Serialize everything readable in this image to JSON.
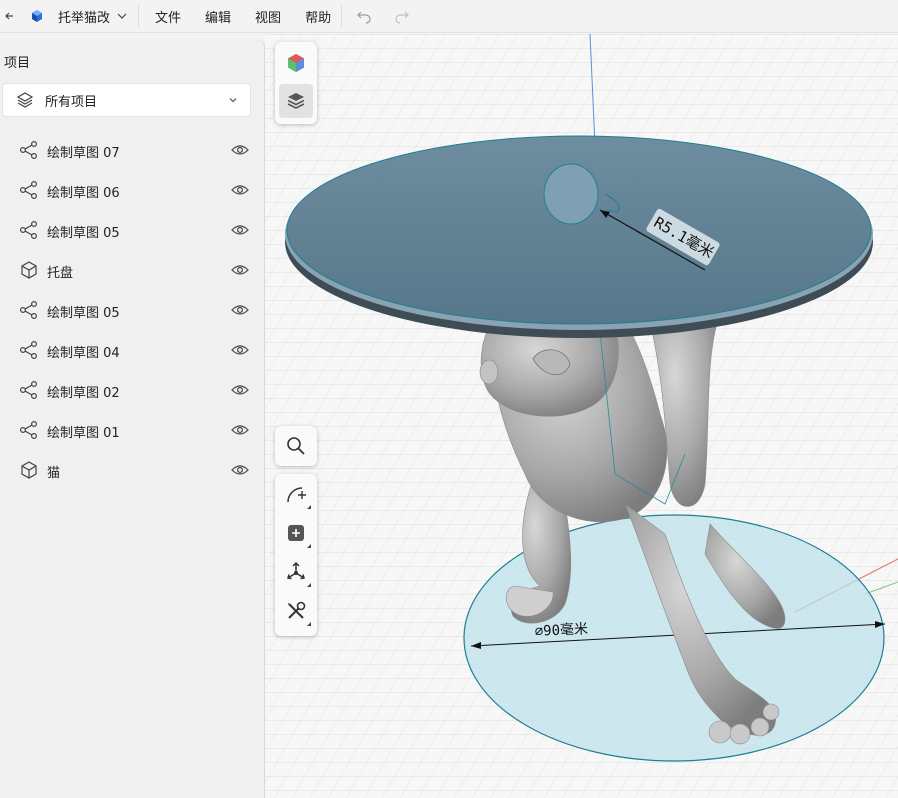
{
  "menubar": {
    "document_title": "托举猫改",
    "menus": [
      "文件",
      "编辑",
      "视图",
      "帮助"
    ]
  },
  "panel": {
    "title": "项目",
    "filter_label": "所有项目",
    "items": [
      {
        "label": "绘制草图 07",
        "icon": "sketch-icon"
      },
      {
        "label": "绘制草图 06",
        "icon": "sketch-icon"
      },
      {
        "label": "绘制草图 05",
        "icon": "sketch-icon"
      },
      {
        "label": "托盘",
        "icon": "body-cube-icon"
      },
      {
        "label": "绘制草图 05",
        "icon": "sketch-icon"
      },
      {
        "label": "绘制草图 04",
        "icon": "sketch-icon"
      },
      {
        "label": "绘制草图 02",
        "icon": "sketch-icon"
      },
      {
        "label": "绘制草图 01",
        "icon": "sketch-icon"
      },
      {
        "label": "猫",
        "icon": "body-cube-icon"
      }
    ]
  },
  "viewport": {
    "radius_dimension": "R5.1毫米",
    "diameter_dimension": "⌀90毫米"
  },
  "colors": {
    "tray_fill": "#5f7f92",
    "base_circle_fill": "#bfe2ec",
    "sketch_line": "#1f7f93",
    "model_gray": "#a9a9a9"
  }
}
